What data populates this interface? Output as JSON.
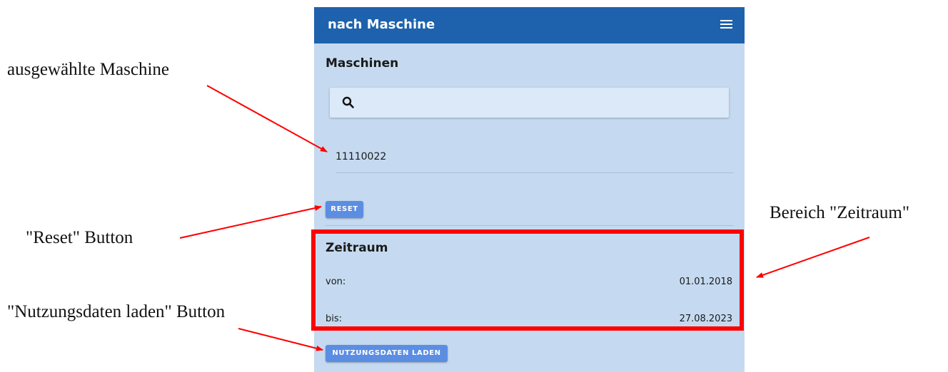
{
  "appbar": {
    "title": "nach Maschine",
    "menu_icon": "hamburger-menu-icon"
  },
  "machines": {
    "section_title": "Maschinen",
    "search_placeholder": "",
    "selected_item": "11110022",
    "reset_label": "RESET"
  },
  "period": {
    "section_title": "Zeitraum",
    "from_label": "von:",
    "from_value": "01.01.2018",
    "to_label": "bis:",
    "to_value": "27.08.2023"
  },
  "load_button_label": "NUTZUNGSDATEN LADEN",
  "annotations": {
    "selected_machine": "ausgewählte Maschine",
    "reset_button": "\"Reset\" Button",
    "load_button": "\"Nutzungsdaten laden\" Button",
    "period_area": "Bereich \"Zeitraum\""
  },
  "colors": {
    "appbar": "#1e62ad",
    "panel": "#c5daf0",
    "button": "#5b8ee2",
    "annotation": "#ff0000"
  }
}
